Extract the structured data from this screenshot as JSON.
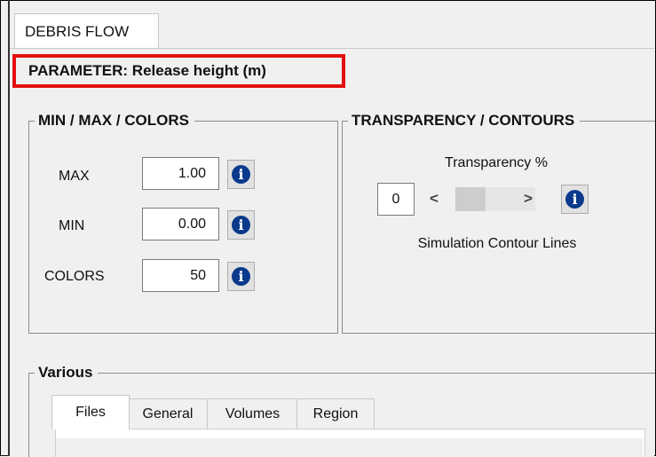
{
  "tab": {
    "label": "DEBRIS FLOW"
  },
  "parameter": {
    "label": "PARAMETER: Release height (m)"
  },
  "minmax": {
    "title": "MIN / MAX / COLORS",
    "rows": [
      {
        "label": "MAX",
        "value": "1.00"
      },
      {
        "label": "MIN",
        "value": "0.00"
      },
      {
        "label": "COLORS",
        "value": "50"
      }
    ]
  },
  "transparency": {
    "title": "TRANSPARENCY / CONTOURS",
    "label": "Transparency %",
    "value": "0",
    "contour_label": "Simulation Contour Lines"
  },
  "various": {
    "title": "Various",
    "tabs": [
      "Files",
      "General",
      "Volumes",
      "Region"
    ]
  },
  "icons": {
    "info": "i",
    "left_arrow": "<",
    "right_arrow": ">"
  },
  "colors": {
    "highlight": "#e31010",
    "info": "#0b3a8c"
  }
}
